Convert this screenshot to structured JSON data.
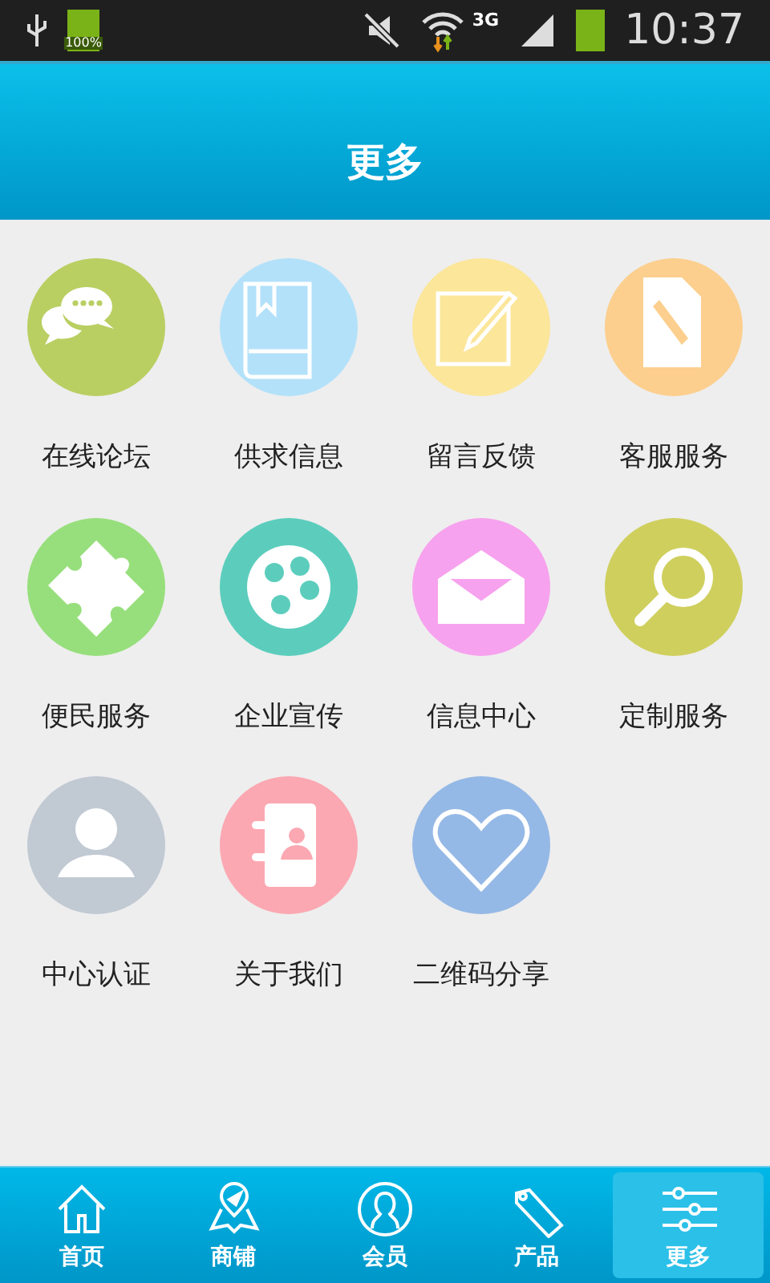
{
  "status_bar": {
    "battery_text": "100%",
    "network": "3G",
    "time": "10:37"
  },
  "header": {
    "title": "更多"
  },
  "grid": [
    {
      "label": "在线论坛",
      "kind": "chat",
      "color": "#b9cf62"
    },
    {
      "label": "供求信息",
      "kind": "book",
      "color": "#b3e1fa"
    },
    {
      "label": "留言反馈",
      "kind": "note",
      "color": "#fbe69a"
    },
    {
      "label": "客服服务",
      "kind": "doc",
      "color": "#fccf8e"
    },
    {
      "label": "便民服务",
      "kind": "puzzle",
      "color": "#97df7c"
    },
    {
      "label": "企业宣传",
      "kind": "reel",
      "color": "#5ccdbd"
    },
    {
      "label": "信息中心",
      "kind": "mail",
      "color": "#f7a2ee"
    },
    {
      "label": "定制服务",
      "kind": "search",
      "color": "#cfcf5e"
    },
    {
      "label": "中心认证",
      "kind": "user",
      "color": "#c1c9d3"
    },
    {
      "label": "关于我们",
      "kind": "contacts",
      "color": "#fba8b2"
    },
    {
      "label": "二维码分享",
      "kind": "heart",
      "color": "#95b9e6"
    }
  ],
  "nav": [
    {
      "label": "首页",
      "kind": "home",
      "selected": false
    },
    {
      "label": "商铺",
      "kind": "map",
      "selected": false
    },
    {
      "label": "会员",
      "kind": "member",
      "selected": false
    },
    {
      "label": "产品",
      "kind": "tag",
      "selected": false
    },
    {
      "label": "更多",
      "kind": "sliders",
      "selected": true
    }
  ]
}
